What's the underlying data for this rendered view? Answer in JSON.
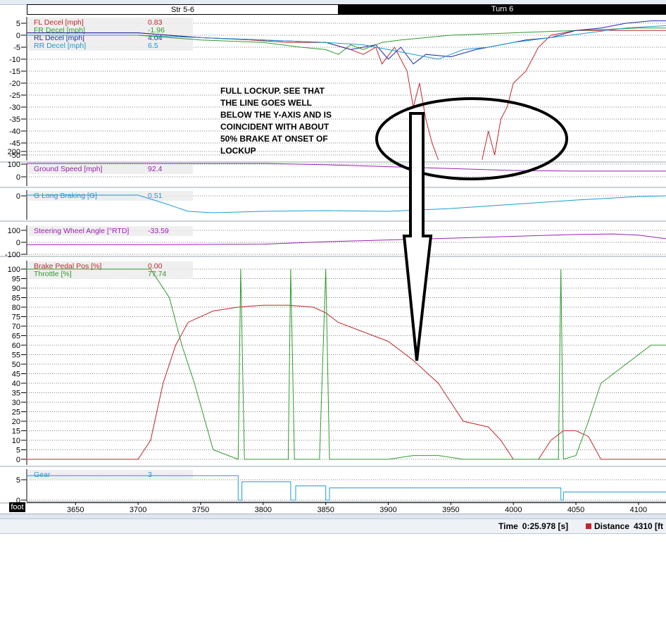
{
  "segments": [
    "Str 5-6",
    "Turn 6"
  ],
  "axis_unit": "foot",
  "status": {
    "time_label": "Time",
    "time_value": "0:25.978 [s]",
    "distance_label": "Distance",
    "distance_value": "4310 [ft"
  },
  "annotation": [
    "FULL LOCKUP. SEE THAT",
    "THE LINE GOES WELL",
    "BELOW THE Y-AXIS AND IS",
    "COINCIDENT WITH ABOUT",
    "50% BRAKE AT ONSET OF",
    "LOCKUP"
  ],
  "colors": {
    "fl": "#c0282b",
    "fr": "#2f9a2f",
    "rl": "#1d2aa8",
    "rr": "#1c9bd0",
    "speed": "#9b1fb0",
    "glong": "#1c9bd0",
    "steer": "#9b1fb0",
    "brake": "#c0282b",
    "throttle": "#2f9a2f",
    "gear": "#1c9bd0"
  },
  "chart_data": {
    "type": "line",
    "x_axis": {
      "label": "foot",
      "ticks": [
        3650,
        3700,
        3750,
        3800,
        3850,
        3900,
        3950,
        4000,
        4050,
        4100
      ],
      "range": [
        3611,
        4122
      ]
    },
    "panels": [
      {
        "id": "decel",
        "yticks": [
          5,
          0,
          -5,
          -10,
          -15,
          -20,
          -25,
          -30,
          -35,
          -40,
          -45,
          -50
        ],
        "ylim": [
          -52,
          8
        ],
        "series": [
          {
            "name": "FL Decel [mph]",
            "value": "0.83",
            "color_key": "fl",
            "x": [
              3611,
              3700,
              3750,
              3790,
              3820,
              3850,
              3870,
              3880,
              3890,
              3895,
              3905,
              3910,
              3915,
              3920,
              3925,
              3930,
              3935,
              3940
            ],
            "y": [
              1,
              1,
              -1,
              -2,
              -3,
              -3,
              -6,
              -8,
              -5,
              -12,
              -5,
              -10,
              -15,
              -30,
              -20,
              -35,
              -45,
              -52
            ]
          },
          {
            "name": "FL Decel [mph]",
            "value": "0.83",
            "color_key": "fl",
            "x": [
              3975,
              3980,
              3985,
              3990,
              3995,
              4000,
              4010,
              4020,
              4030,
              4050,
              4100,
              4122
            ],
            "y": [
              -52,
              -40,
              -50,
              -35,
              -30,
              -20,
              -15,
              -5,
              0,
              2,
              2,
              2
            ]
          },
          {
            "name": "FR Decel [mph]",
            "value": "-1.96",
            "color_key": "fr",
            "x": [
              3611,
              3700,
              3750,
              3800,
              3830,
              3850,
              3860,
              3870,
              3880,
              3895,
              3910,
              3930,
              3950,
              4000,
              4050,
              4100,
              4122
            ],
            "y": [
              0,
              0,
              -2,
              -3,
              -5,
              -6,
              -8,
              -4,
              -6,
              -3,
              -2,
              -1,
              0,
              1,
              2,
              3,
              3
            ]
          },
          {
            "name": "RL Decel [mph]",
            "value": "4.04",
            "color_key": "rl",
            "x": [
              3611,
              3700,
              3750,
              3800,
              3850,
              3870,
              3890,
              3900,
              3910,
              3920,
              3930,
              3950,
              3970,
              3990,
              4010,
              4030,
              4050,
              4070,
              4090,
              4110,
              4122
            ],
            "y": [
              1,
              1,
              -1,
              -2,
              -3,
              -6,
              -4,
              -10,
              -5,
              -12,
              -8,
              -9,
              -6,
              -4,
              -2,
              -1,
              2,
              3,
              5,
              6,
              6
            ]
          },
          {
            "name": "RR Decel [mph]",
            "value": "6.5",
            "color_key": "rr",
            "x": [
              3611,
              3700,
              3750,
              3800,
              3850,
              3880,
              3900,
              3920,
              3940,
              3960,
              3980,
              4000,
              4030,
              4060,
              4090,
              4122
            ],
            "y": [
              0,
              0,
              -1,
              -2,
              -3,
              -4,
              -6,
              -8,
              -10,
              -6,
              -5,
              -3,
              -1,
              1,
              3,
              4
            ]
          }
        ]
      },
      {
        "id": "speed",
        "yticks": [
          200,
          100,
          0
        ],
        "ylim": [
          0,
          210
        ],
        "series": [
          {
            "name": "Ground Speed [mph]",
            "value": "92.4",
            "color_key": "speed",
            "x": [
              3611,
              3700,
              3750,
              3800,
              3850,
              3900,
              3950,
              4000,
              4050,
              4100,
              4122
            ],
            "y": [
              125,
              122,
              118,
              110,
              95,
              80,
              65,
              50,
              45,
              45,
              45
            ]
          }
        ]
      },
      {
        "id": "glong",
        "yticks": [
          0
        ],
        "ylim": [
          -1.5,
          0.5
        ],
        "series": [
          {
            "name": "G Long Braking [G]",
            "value": "0.51",
            "color_key": "glong",
            "x": [
              3611,
              3700,
              3720,
              3740,
              3760,
              3800,
              3850,
              3900,
              3950,
              4000,
              4050,
              4100,
              4122
            ],
            "y": [
              0.05,
              0.05,
              -0.5,
              -1.1,
              -1.2,
              -1.1,
              -1.05,
              -1.1,
              -0.9,
              -0.6,
              -0.3,
              -0.05,
              0
            ]
          }
        ]
      },
      {
        "id": "steer",
        "yticks": [
          100,
          0,
          -100
        ],
        "ylim": [
          -110,
          120
        ],
        "series": [
          {
            "name": "Steering Wheel Angle [°RTD]",
            "value": "-33.59",
            "color_key": "steer",
            "x": [
              3611,
              3700,
              3800,
              3850,
              3900,
              3950,
              4000,
              4050,
              4080,
              4100,
              4122
            ],
            "y": [
              -20,
              -20,
              -15,
              5,
              20,
              35,
              50,
              65,
              70,
              60,
              30
            ]
          }
        ]
      },
      {
        "id": "pedals",
        "yticks": [
          100,
          95,
          90,
          85,
          80,
          75,
          70,
          65,
          60,
          55,
          50,
          45,
          40,
          35,
          30,
          25,
          20,
          15,
          10,
          5,
          0
        ],
        "ylim": [
          0,
          100
        ],
        "series": [
          {
            "name": "Brake Pedal Pos [%]",
            "value": "0.00",
            "color_key": "brake",
            "x": [
              3611,
              3700,
              3710,
              3720,
              3730,
              3740,
              3760,
              3780,
              3800,
              3820,
              3840,
              3850,
              3860,
              3880,
              3900,
              3920,
              3940,
              3960,
              3980,
              3990,
              4000,
              4010,
              4020,
              4030,
              4040,
              4050,
              4060,
              4070,
              4080,
              4090,
              4122
            ],
            "y": [
              0,
              0,
              10,
              40,
              60,
              72,
              78,
              80,
              81,
              81,
              80,
              77,
              72,
              67,
              62,
              52,
              40,
              20,
              17,
              10,
              0,
              0,
              0,
              10,
              15,
              15,
              12,
              0,
              0,
              0,
              0
            ]
          },
          {
            "name": "Throttle [%]",
            "value": "77.74",
            "color_key": "throttle",
            "x": [
              3611,
              3710,
              3725,
              3735,
              3745,
              3760,
              3780,
              3782,
              3785,
              3790,
              3820,
              3822,
              3825,
              3830,
              3845,
              3850,
              3853,
              3860,
              3900,
              3920,
              3940,
              3960,
              3980,
              4000,
              4030,
              4036,
              4038,
              4040,
              4050,
              4060,
              4070,
              4080,
              4090,
              4100,
              4110,
              4122
            ],
            "y": [
              100,
              100,
              85,
              60,
              40,
              5,
              0,
              100,
              0,
              0,
              0,
              100,
              0,
              0,
              0,
              100,
              0,
              0,
              0,
              2,
              2,
              0,
              0,
              0,
              0,
              0,
              100,
              0,
              2,
              20,
              40,
              45,
              50,
              55,
              60,
              60
            ]
          }
        ]
      },
      {
        "id": "gear",
        "yticks": [
          5,
          0
        ],
        "ylim": [
          0,
          7
        ],
        "series": [
          {
            "name": "Gear",
            "value": "3",
            "color_key": "gear",
            "x": [
              3611,
              3780,
              3780,
              3783,
              3783,
              3822,
              3822,
              3826,
              3826,
              3850,
              3850,
              3853,
              3853,
              4038,
              4038,
              4040,
              4040,
              4122
            ],
            "y": [
              6,
              6,
              0,
              0,
              4.5,
              4.5,
              0,
              0,
              3.5,
              3.5,
              0,
              0,
              3,
              3,
              0,
              0,
              2,
              2
            ]
          }
        ]
      }
    ]
  }
}
